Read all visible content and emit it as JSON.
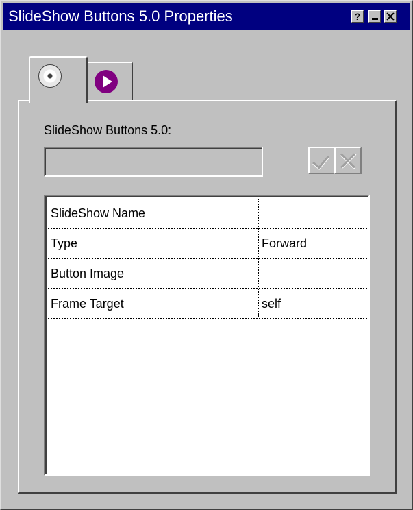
{
  "window": {
    "title": "SlideShow Buttons 5.0 Properties",
    "help_label": "?"
  },
  "tabs": [
    {
      "icon": "cd-icon",
      "active": true
    },
    {
      "icon": "play-icon",
      "active": false
    }
  ],
  "panel": {
    "section_label": "SlideShow Buttons 5.0:",
    "name_value": "",
    "properties": [
      {
        "name": "SlideShow Name",
        "value": ""
      },
      {
        "name": "Type",
        "value": "Forward"
      },
      {
        "name": "Button Image",
        "value": ""
      },
      {
        "name": "Frame Target",
        "value": "self"
      }
    ]
  },
  "colors": {
    "titlebar": "#000080",
    "face": "#c0c0c0",
    "play_icon": "#800080"
  }
}
